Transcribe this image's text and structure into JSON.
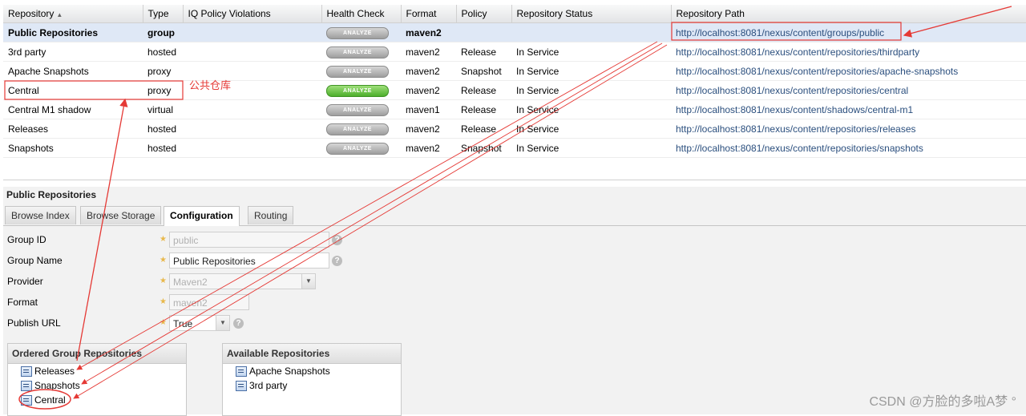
{
  "grid": {
    "columns": [
      "Repository",
      "Type",
      "IQ Policy Violations",
      "Health Check",
      "Format",
      "Policy",
      "Repository Status",
      "Repository Path"
    ],
    "rows": [
      {
        "name": "Public Repositories",
        "type": "group",
        "iq": "",
        "health": "ANALYZE",
        "health_active": false,
        "format": "maven2",
        "policy": "",
        "status": "",
        "path": "http://localhost:8081/nexus/content/groups/public"
      },
      {
        "name": "3rd party",
        "type": "hosted",
        "iq": "",
        "health": "ANALYZE",
        "health_active": false,
        "format": "maven2",
        "policy": "Release",
        "status": "In Service",
        "path": "http://localhost:8081/nexus/content/repositories/thirdparty"
      },
      {
        "name": "Apache Snapshots",
        "type": "proxy",
        "iq": "",
        "health": "ANALYZE",
        "health_active": false,
        "format": "maven2",
        "policy": "Snapshot",
        "status": "In Service",
        "path": "http://localhost:8081/nexus/content/repositories/apache-snapshots"
      },
      {
        "name": "Central",
        "type": "proxy",
        "iq": "",
        "health": "ANALYZE",
        "health_active": true,
        "format": "maven2",
        "policy": "Release",
        "status": "In Service",
        "path": "http://localhost:8081/nexus/content/repositories/central"
      },
      {
        "name": "Central M1 shadow",
        "type": "virtual",
        "iq": "",
        "health": "ANALYZE",
        "health_active": false,
        "format": "maven1",
        "policy": "Release",
        "status": "In Service",
        "path": "http://localhost:8081/nexus/content/shadows/central-m1"
      },
      {
        "name": "Releases",
        "type": "hosted",
        "iq": "",
        "health": "ANALYZE",
        "health_active": false,
        "format": "maven2",
        "policy": "Release",
        "status": "In Service",
        "path": "http://localhost:8081/nexus/content/repositories/releases"
      },
      {
        "name": "Snapshots",
        "type": "hosted",
        "iq": "",
        "health": "ANALYZE",
        "health_active": false,
        "format": "maven2",
        "policy": "Snapshot",
        "status": "In Service",
        "path": "http://localhost:8081/nexus/content/repositories/snapshots"
      }
    ]
  },
  "panel": {
    "title": "Public Repositories",
    "tabs": [
      "Browse Index",
      "Browse Storage",
      "Configuration",
      "Routing"
    ],
    "active_tab": "Configuration",
    "form": {
      "group_id_label": "Group ID",
      "group_id_value": "public",
      "group_name_label": "Group Name",
      "group_name_value": "Public Repositories",
      "provider_label": "Provider",
      "provider_value": "Maven2",
      "format_label": "Format",
      "format_value": "maven2",
      "publish_url_label": "Publish URL",
      "publish_url_value": "True"
    },
    "ordered": {
      "title": "Ordered Group Repositories",
      "items": [
        "Releases",
        "Snapshots",
        "Central"
      ]
    },
    "available": {
      "title": "Available Repositories",
      "items": [
        "Apache Snapshots",
        "3rd party"
      ]
    }
  },
  "annotation": {
    "label": "公共仓库",
    "color": "#e53935"
  },
  "watermark": "CSDN @方脸的多啦A梦 °"
}
